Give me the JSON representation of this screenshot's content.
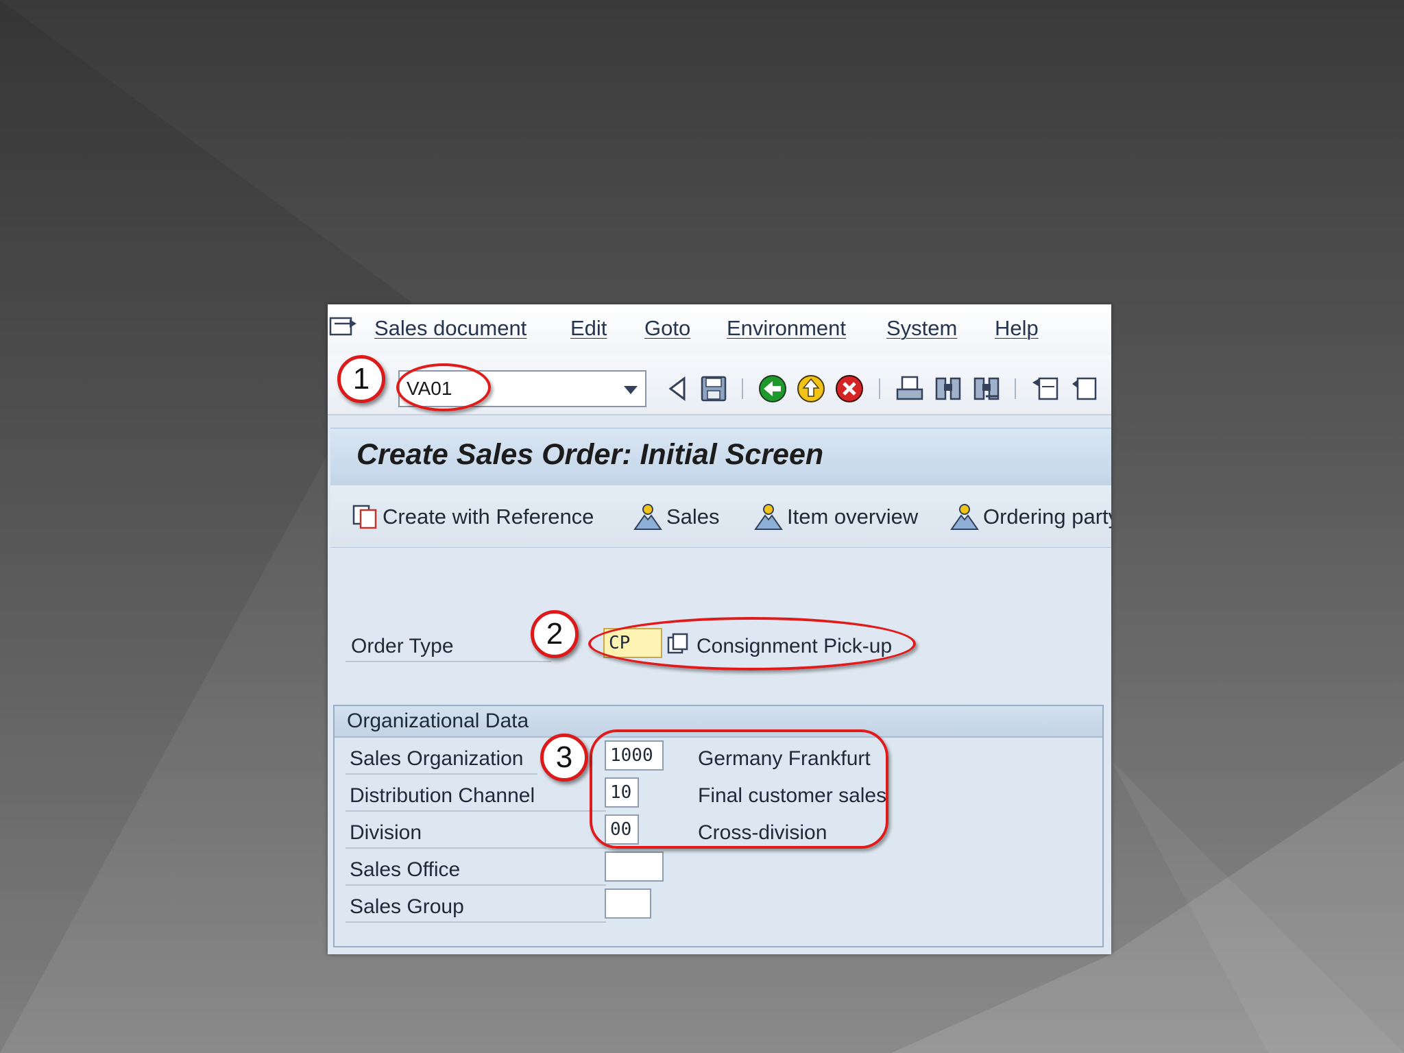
{
  "menu": {
    "items": [
      "Sales document",
      "Edit",
      "Goto",
      "Environment",
      "System",
      "Help"
    ]
  },
  "toolbar": {
    "command_value": "VA01",
    "icons": [
      "back-arrow-icon",
      "save-icon",
      "back-green-icon",
      "exit-yellow-icon",
      "cancel-red-icon",
      "print-icon",
      "find-icon",
      "find-next-icon",
      "first-page-icon",
      "prev-page-icon"
    ]
  },
  "title": "Create Sales Order: Initial Screen",
  "app_toolbar": {
    "create_with_reference": "Create with Reference",
    "sales": "Sales",
    "item_overview": "Item overview",
    "ordering_party": "Ordering party"
  },
  "order_type": {
    "label": "Order Type",
    "value": "CP",
    "description": "Consignment Pick-up"
  },
  "org_data": {
    "title": "Organizational Data",
    "sales_org": {
      "label": "Sales Organization",
      "value": "1000",
      "description": "Germany Frankfurt"
    },
    "dist_channel": {
      "label": "Distribution Channel",
      "value": "10",
      "description": "Final customer sales"
    },
    "division": {
      "label": "Division",
      "value": "00",
      "description": "Cross-division"
    },
    "sales_office": {
      "label": "Sales Office",
      "value": ""
    },
    "sales_group": {
      "label": "Sales Group",
      "value": ""
    }
  },
  "callouts": [
    "1",
    "2",
    "3"
  ],
  "colors": {
    "annotation_red": "#e01b1b",
    "required_field": "#fff3b4",
    "sap_blue": "#dfe8f2"
  }
}
